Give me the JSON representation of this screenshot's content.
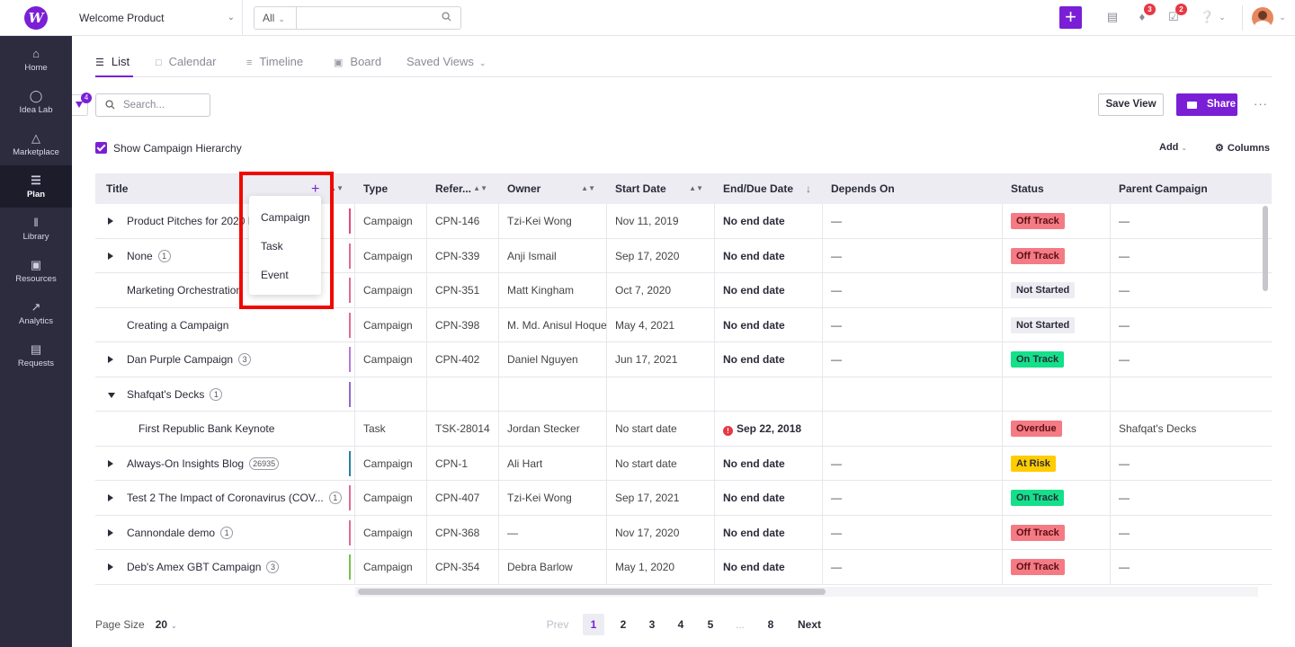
{
  "app": {
    "workspace": "Welcome Product",
    "brand_color": "#7a1fd6"
  },
  "topbar": {
    "search_scope": "All",
    "search_placeholder": "",
    "notifications_badge": "3",
    "tasks_badge": "2"
  },
  "sidebar": {
    "items": [
      {
        "label": "Home",
        "icon": "home-icon"
      },
      {
        "label": "Idea Lab",
        "icon": "lightbulb-icon"
      },
      {
        "label": "Marketplace",
        "icon": "store-icon"
      },
      {
        "label": "Plan",
        "icon": "list-icon"
      },
      {
        "label": "Library",
        "icon": "library-icon"
      },
      {
        "label": "Resources",
        "icon": "database-icon"
      },
      {
        "label": "Analytics",
        "icon": "trend-icon"
      },
      {
        "label": "Requests",
        "icon": "document-icon"
      }
    ]
  },
  "views": {
    "tabs": [
      {
        "label": "List"
      },
      {
        "label": "Calendar"
      },
      {
        "label": "Timeline"
      },
      {
        "label": "Board"
      },
      {
        "label": "Saved Views"
      }
    ]
  },
  "toolbar": {
    "filter_count": "4",
    "search_placeholder": "Search...",
    "save_view": "Save View",
    "share": "Share",
    "more": "···",
    "show_hierarchy": "Show Campaign Hierarchy",
    "add": "Add",
    "columns": "Columns"
  },
  "table": {
    "headers": [
      "Title",
      "Type",
      "Refer...",
      "Owner",
      "Start Date",
      "End/Due Date",
      "Depends On",
      "Status",
      "Parent Campaign"
    ],
    "rows": [
      {
        "title": "Product Pitches for 2020 L",
        "count": "",
        "type": "Campaign",
        "ref": "CPN-146",
        "owner": "Tzi-Kei Wong",
        "start": "Nov 11, 2019",
        "end": "No end date",
        "depends": "—",
        "status": "Off Track",
        "parent": "—"
      },
      {
        "title": "None",
        "count": "1",
        "type": "Campaign",
        "ref": "CPN-339",
        "owner": "Anji Ismail",
        "start": "Sep 17, 2020",
        "end": "No end date",
        "depends": "—",
        "status": "Off Track",
        "parent": "—"
      },
      {
        "title": "Marketing Orchestration",
        "count": "",
        "type": "Campaign",
        "ref": "CPN-351",
        "owner": "Matt Kingham",
        "start": "Oct 7, 2020",
        "end": "No end date",
        "depends": "—",
        "status": "Not Started",
        "parent": "—"
      },
      {
        "title": "Creating a Campaign",
        "count": "",
        "type": "Campaign",
        "ref": "CPN-398",
        "owner": "M. Md. Anisul Hoque",
        "start": "May 4, 2021",
        "end": "No end date",
        "depends": "—",
        "status": "Not Started",
        "parent": "—"
      },
      {
        "title": "Dan Purple Campaign",
        "count": "3",
        "type": "Campaign",
        "ref": "CPN-402",
        "owner": "Daniel Nguyen",
        "start": "Jun 17, 2021",
        "end": "No end date",
        "depends": "—",
        "status": "On Track",
        "parent": "—"
      },
      {
        "title": "Shafqat's Decks",
        "count": "1",
        "type": "",
        "ref": "",
        "owner": "",
        "start": "",
        "end": "",
        "depends": "",
        "status": "",
        "parent": ""
      },
      {
        "title": "First Republic Bank Keynote",
        "count": "",
        "type": "Task",
        "ref": "TSK-28014",
        "owner": "Jordan Stecker",
        "start": "No start date",
        "end": "Sep 22, 2018",
        "depends": "",
        "status": "Overdue",
        "parent": "Shafqat's Decks"
      },
      {
        "title": "Always-On Insights Blog",
        "count": "26935",
        "type": "Campaign",
        "ref": "CPN-1",
        "owner": "Ali Hart",
        "start": "No start date",
        "end": "No end date",
        "depends": "—",
        "status": "At Risk",
        "parent": "—"
      },
      {
        "title": "Test 2 The Impact of Coronavirus (COV...",
        "count": "1",
        "type": "Campaign",
        "ref": "CPN-407",
        "owner": "Tzi-Kei Wong",
        "start": "Sep 17, 2021",
        "end": "No end date",
        "depends": "—",
        "status": "On Track",
        "parent": "—"
      },
      {
        "title": "Cannondale demo",
        "count": "1",
        "type": "Campaign",
        "ref": "CPN-368",
        "owner": "—",
        "start": "Nov 17, 2020",
        "end": "No end date",
        "depends": "—",
        "status": "Off Track",
        "parent": "—"
      },
      {
        "title": "Deb's Amex GBT Campaign",
        "count": "3",
        "type": "Campaign",
        "ref": "CPN-354",
        "owner": "Debra Barlow",
        "start": "May 1, 2020",
        "end": "No end date",
        "depends": "—",
        "status": "Off Track",
        "parent": "—"
      }
    ],
    "status_colors": {
      "Off Track": "#f47a84",
      "Not Started": "#ececf2",
      "On Track": "#14e08a",
      "Overdue": "#f47a84",
      "At Risk": "#ffcc00"
    }
  },
  "add_menu": {
    "options": [
      "Campaign",
      "Task",
      "Event"
    ]
  },
  "pagination": {
    "page_size_label": "Page Size",
    "page_size": "20",
    "prev": "Prev",
    "pages": [
      "1",
      "2",
      "3",
      "4",
      "5",
      "...",
      "8"
    ],
    "next": "Next"
  }
}
